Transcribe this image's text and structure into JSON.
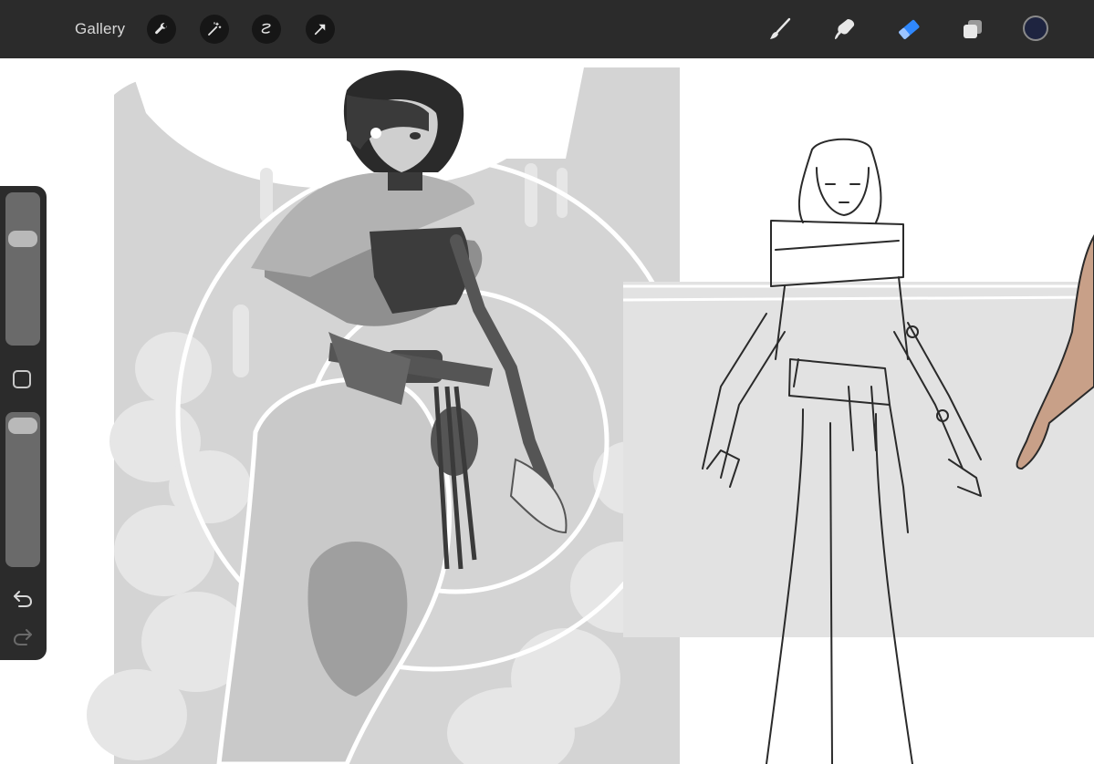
{
  "toolbar": {
    "gallery_label": "Gallery",
    "left_tools": [
      "wrench-icon",
      "magic-wand-icon",
      "selection-icon",
      "transform-arrow-icon"
    ],
    "right_tools": [
      "brush-icon",
      "smudge-icon",
      "eraser-icon",
      "layers-icon"
    ],
    "active_tool": "eraser",
    "active_color": "#1e2440",
    "highlight_color": "#2f88ff"
  },
  "sidebar": {
    "brush_size_level": 0.27,
    "opacity_level": 0.02
  }
}
